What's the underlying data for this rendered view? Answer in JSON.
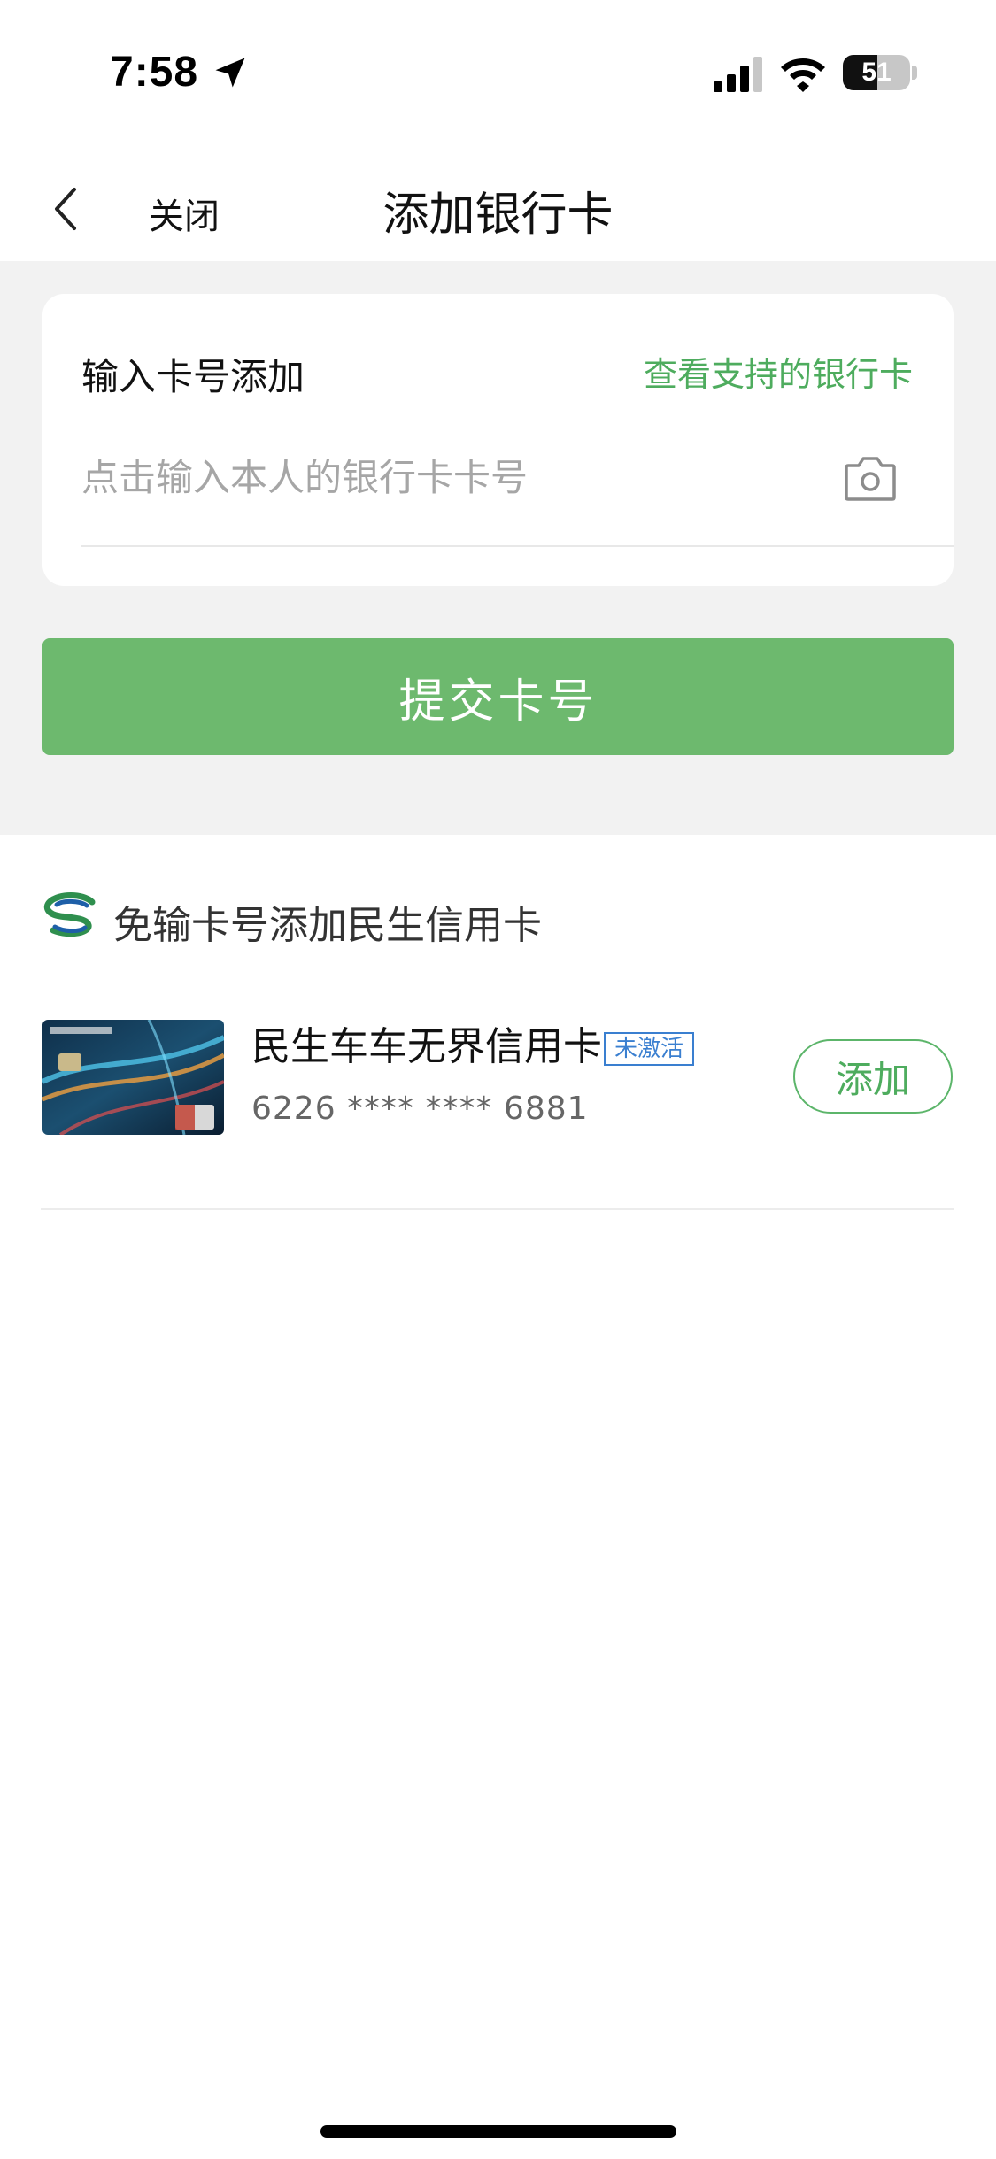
{
  "status_bar": {
    "time": "7:58",
    "battery": "51",
    "battery_level": 0.51
  },
  "nav": {
    "close_label": "关闭",
    "title": "添加银行卡"
  },
  "input_card": {
    "title": "输入卡号添加",
    "supported_link": "查看支持的银行卡",
    "placeholder": "点击输入本人的银行卡卡号",
    "value": ""
  },
  "submit_label": "提交卡号",
  "bank_section": {
    "header": "免输卡号添加民生信用卡",
    "cards": [
      {
        "name": "民生车车无界信用卡",
        "status": "未激活",
        "number": "6226 **** **** 6881",
        "add_label": "添加"
      }
    ]
  },
  "colors": {
    "accent_green": "#6db96e",
    "link_green": "#4eac5e",
    "badge_blue": "#3a7fd0",
    "page_gray": "#f2f2f2"
  }
}
